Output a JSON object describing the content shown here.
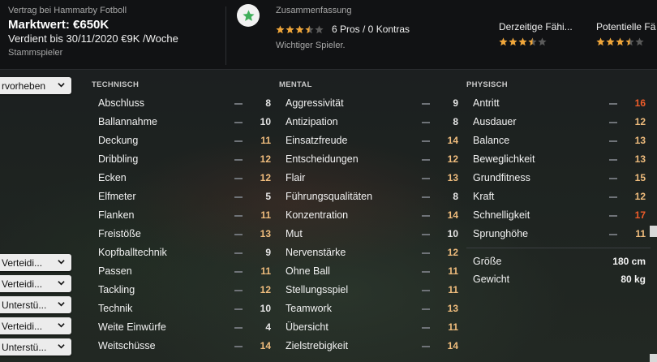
{
  "contract": {
    "label": "Vertrag bei Hammarby Fotboll",
    "market_value": "Marktwert: €650K",
    "until": "Verdient bis 30/11/2020 €9K /Woche",
    "role": "Stammspieler"
  },
  "summary": {
    "label": "Zusammenfassung",
    "stars": 3.5,
    "pros_cons": "6 Pros / 0 Kontras",
    "description": "Wichtiger Spieler."
  },
  "abilities": [
    {
      "label": "Derzeitige Fähi...",
      "stars": 3.5
    },
    {
      "label": "Potentielle Fä",
      "stars": 3.5
    }
  ],
  "dropdowns": [
    {
      "label": "rvorheben"
    },
    {
      "label": "Verteidi..."
    },
    {
      "label": "Verteidi..."
    },
    {
      "label": "Unterstü..."
    },
    {
      "label": "Verteidi..."
    },
    {
      "label": "Unterstü..."
    }
  ],
  "technical": {
    "title": "TECHNISCH",
    "items": [
      {
        "name": "Abschluss",
        "value": "8",
        "tier": "white"
      },
      {
        "name": "Ballannahme",
        "value": "10",
        "tier": "white"
      },
      {
        "name": "Deckung",
        "value": "11",
        "tier": "lorange"
      },
      {
        "name": "Dribbling",
        "value": "12",
        "tier": "lorange"
      },
      {
        "name": "Ecken",
        "value": "12",
        "tier": "lorange"
      },
      {
        "name": "Elfmeter",
        "value": "5",
        "tier": "white"
      },
      {
        "name": "Flanken",
        "value": "11",
        "tier": "lorange"
      },
      {
        "name": "Freistöße",
        "value": "13",
        "tier": "lorange"
      },
      {
        "name": "Kopfballtechnik",
        "value": "9",
        "tier": "white"
      },
      {
        "name": "Passen",
        "value": "11",
        "tier": "lorange"
      },
      {
        "name": "Tackling",
        "value": "12",
        "tier": "lorange"
      },
      {
        "name": "Technik",
        "value": "10",
        "tier": "white"
      },
      {
        "name": "Weite Einwürfe",
        "value": "4",
        "tier": "white"
      },
      {
        "name": "Weitschüsse",
        "value": "14",
        "tier": "lorange"
      }
    ]
  },
  "mental": {
    "title": "MENTAL",
    "items": [
      {
        "name": "Aggressivität",
        "value": "9",
        "tier": "white"
      },
      {
        "name": "Antizipation",
        "value": "8",
        "tier": "white"
      },
      {
        "name": "Einsatzfreude",
        "value": "14",
        "tier": "lorange"
      },
      {
        "name": "Entscheidungen",
        "value": "12",
        "tier": "lorange"
      },
      {
        "name": "Flair",
        "value": "13",
        "tier": "lorange"
      },
      {
        "name": "Führungsqualitäten",
        "value": "8",
        "tier": "white"
      },
      {
        "name": "Konzentration",
        "value": "14",
        "tier": "lorange"
      },
      {
        "name": "Mut",
        "value": "10",
        "tier": "white"
      },
      {
        "name": "Nervenstärke",
        "value": "12",
        "tier": "lorange"
      },
      {
        "name": "Ohne Ball",
        "value": "11",
        "tier": "lorange"
      },
      {
        "name": "Stellungsspiel",
        "value": "11",
        "tier": "lorange"
      },
      {
        "name": "Teamwork",
        "value": "13",
        "tier": "lorange"
      },
      {
        "name": "Übersicht",
        "value": "11",
        "tier": "lorange"
      },
      {
        "name": "Zielstrebigkeit",
        "value": "14",
        "tier": "lorange"
      }
    ]
  },
  "physical": {
    "title": "PHYSISCH",
    "items": [
      {
        "name": "Antritt",
        "value": "16",
        "tier": "red"
      },
      {
        "name": "Ausdauer",
        "value": "12",
        "tier": "lorange"
      },
      {
        "name": "Balance",
        "value": "13",
        "tier": "lorange"
      },
      {
        "name": "Beweglichkeit",
        "value": "13",
        "tier": "lorange"
      },
      {
        "name": "Grundfitness",
        "value": "15",
        "tier": "lorange"
      },
      {
        "name": "Kraft",
        "value": "12",
        "tier": "lorange"
      },
      {
        "name": "Schnelligkeit",
        "value": "17",
        "tier": "red"
      },
      {
        "name": "Sprunghöhe",
        "value": "11",
        "tier": "lorange"
      }
    ]
  },
  "bio": [
    {
      "key": "Größe",
      "value": "180 cm"
    },
    {
      "key": "Gewicht",
      "value": "80 kg"
    }
  ],
  "colors": {
    "star": "#f0a63a",
    "star_empty": "#5a5a5a",
    "badge_star": "#3fae5a"
  }
}
